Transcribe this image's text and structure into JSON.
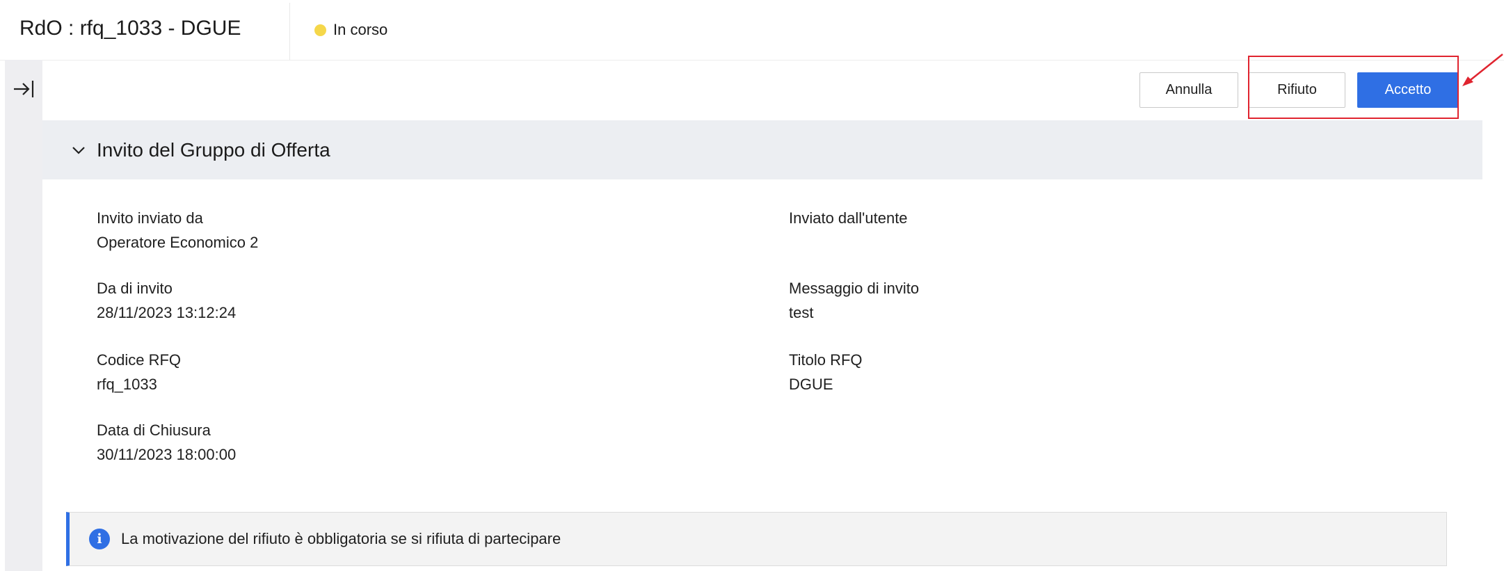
{
  "header": {
    "title": "RdO : rfq_1033 - DGUE",
    "status_label": "In corso",
    "status_color": "#f5d74a"
  },
  "left_rail": {
    "toggle_icon": "expand-panel-icon"
  },
  "toolbar": {
    "cancel_label": "Annulla",
    "reject_label": "Rifiuto",
    "accept_label": "Accetto",
    "accent_color": "#2f6fe4",
    "highlight_color": "#e0242f"
  },
  "section": {
    "title": "Invito del Gruppo di Offerta",
    "expanded": true
  },
  "fields": [
    {
      "label": "Invito inviato da",
      "value": "Operatore Economico 2"
    },
    {
      "label": "Inviato dall'utente",
      "value": ""
    },
    {
      "label": "Da di invito",
      "value": "28/11/2023 13:12:24"
    },
    {
      "label": "Messaggio di invito",
      "value": "test"
    },
    {
      "label": "Codice RFQ",
      "value": "rfq_1033"
    },
    {
      "label": "Titolo RFQ",
      "value": "DGUE"
    },
    {
      "label": "Data di Chiusura",
      "value": "30/11/2023 18:00:00"
    }
  ],
  "info_banner": {
    "text": "La motivazione del rifiuto è obbligatoria se si rifiuta di partecipare",
    "icon": "info-icon"
  }
}
